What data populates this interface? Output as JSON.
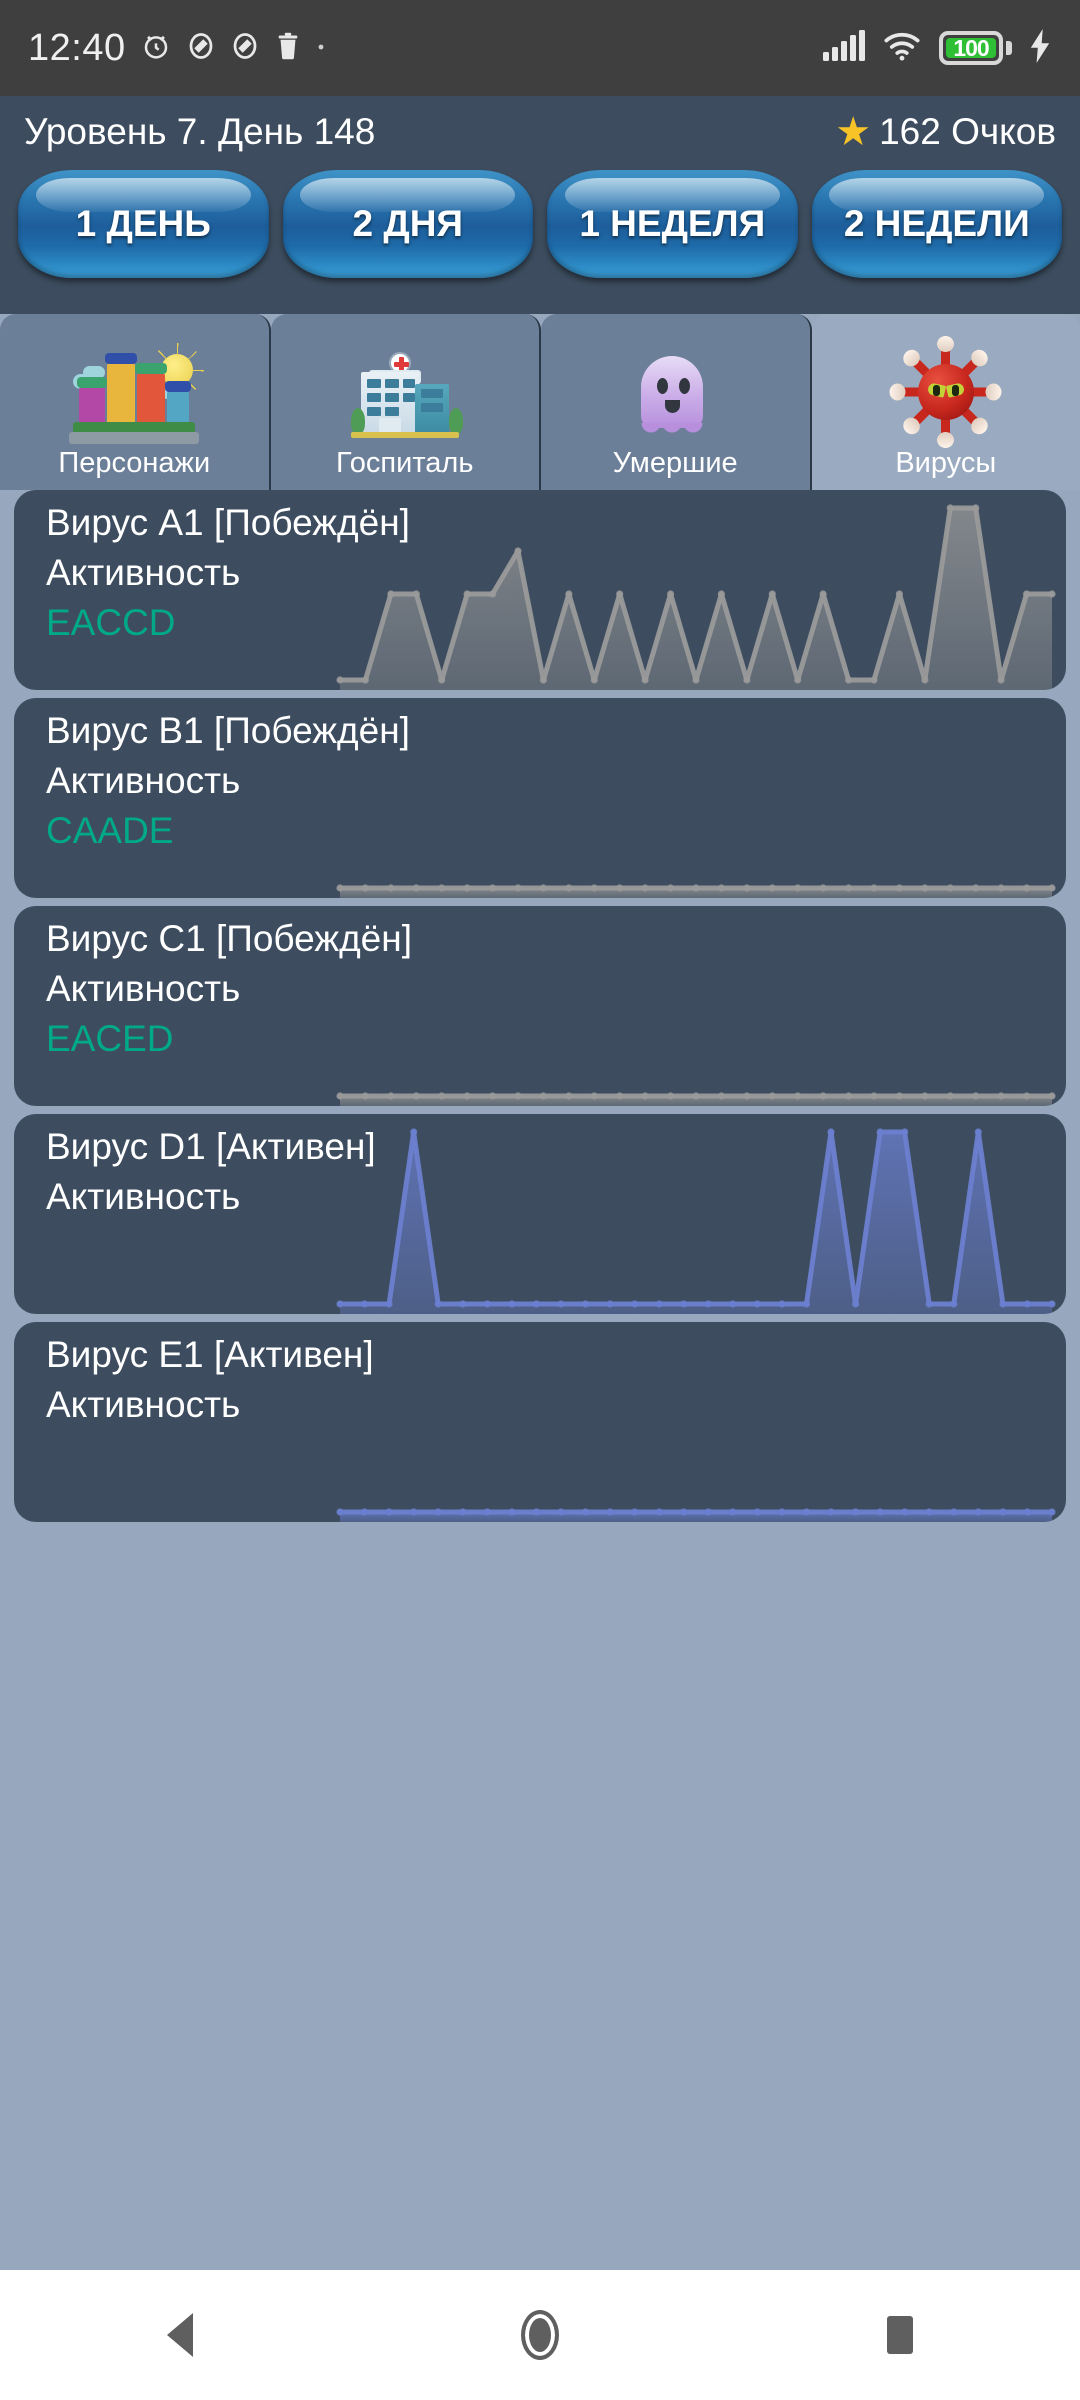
{
  "status_bar": {
    "clock": "12:40",
    "left_icons": [
      "alarm-icon",
      "do-not-disturb-icon",
      "do-not-disturb-icon",
      "trash-icon",
      "dot-icon"
    ],
    "right_icons": [
      "signal-icon",
      "wifi-icon"
    ],
    "battery_percent": "100",
    "battery_color": "#2fbf34",
    "charging": true
  },
  "header": {
    "level_text": "Уровень 7. День 148",
    "score_text": "162 Очков",
    "star_icon": "star-icon",
    "speed_buttons": [
      {
        "label": "1 ДЕНЬ"
      },
      {
        "label": "2 ДНЯ"
      },
      {
        "label": "1 НЕДЕЛЯ"
      },
      {
        "label": "2 НЕДЕЛИ"
      }
    ]
  },
  "tabs": [
    {
      "label": "Персонажи",
      "icon": "city-icon",
      "active": false
    },
    {
      "label": "Госпиталь",
      "icon": "hospital-icon",
      "active": false
    },
    {
      "label": "Умершие",
      "icon": "ghost-icon",
      "active": false
    },
    {
      "label": "Вирусы",
      "icon": "virus-icon",
      "active": true
    }
  ],
  "colors": {
    "page_background": "#96a7be",
    "card_background": "#3d4d5f",
    "header_background": "#3d4d5f",
    "code_text": "#00a98a",
    "defeated_chart": "#9a9a9a",
    "active_chart": "#6b7fd0"
  },
  "cards": [
    {
      "title": "Вирус A1 [Побеждён]",
      "subtitle": "Активность",
      "code": "EACCD",
      "status": "Побеждён",
      "chart_color": "#9a9a9a"
    },
    {
      "title": "Вирус B1 [Побеждён]",
      "subtitle": "Активность",
      "code": "CAADE",
      "status": "Побеждён",
      "chart_color": "#9a9a9a"
    },
    {
      "title": "Вирус C1 [Побеждён]",
      "subtitle": "Активность",
      "code": "EACED",
      "status": "Побеждён",
      "chart_color": "#9a9a9a"
    },
    {
      "title": "Вирус D1 [Активен]",
      "subtitle": "Активность",
      "code": "",
      "status": "Активен",
      "chart_color": "#6b7fd0"
    },
    {
      "title": "Вирус E1 [Активен]",
      "subtitle": "Активность",
      "code": "",
      "status": "Активен",
      "chart_color": "#6b7fd0"
    }
  ],
  "chart_data": [
    {
      "type": "area",
      "title": "Вирус A1 Активность",
      "series": [
        {
          "name": "Активность",
          "values": [
            0,
            0,
            2,
            2,
            0,
            2,
            2,
            3,
            0,
            2,
            0,
            2,
            0,
            2,
            0,
            2,
            0,
            2,
            0,
            2,
            0,
            0,
            2,
            0,
            4,
            4,
            0,
            2,
            2
          ]
        }
      ],
      "x": [
        1,
        2,
        3,
        4,
        5,
        6,
        7,
        8,
        9,
        10,
        11,
        12,
        13,
        14,
        15,
        16,
        17,
        18,
        19,
        20,
        21,
        22,
        23,
        24,
        25,
        26,
        27,
        28,
        29
      ],
      "ylim": [
        0,
        4
      ],
      "grid": false,
      "legend": "none",
      "color": "#9a9a9a"
    },
    {
      "type": "area",
      "title": "Вирус B1 Активность",
      "series": [
        {
          "name": "Активность",
          "values": [
            0,
            0,
            0,
            0,
            0,
            0,
            0,
            0,
            0,
            0,
            0,
            0,
            0,
            0,
            0,
            0,
            0,
            0,
            0,
            0,
            0,
            0,
            0,
            0,
            0,
            0,
            0,
            0,
            0
          ]
        }
      ],
      "x": [
        1,
        2,
        3,
        4,
        5,
        6,
        7,
        8,
        9,
        10,
        11,
        12,
        13,
        14,
        15,
        16,
        17,
        18,
        19,
        20,
        21,
        22,
        23,
        24,
        25,
        26,
        27,
        28,
        29
      ],
      "ylim": [
        0,
        4
      ],
      "grid": false,
      "legend": "none",
      "color": "#9a9a9a"
    },
    {
      "type": "area",
      "title": "Вирус C1 Активность",
      "series": [
        {
          "name": "Активность",
          "values": [
            0,
            0,
            0,
            0,
            0,
            0,
            0,
            0,
            0,
            0,
            0,
            0,
            0,
            0,
            0,
            0,
            0,
            0,
            0,
            0,
            0,
            0,
            0,
            0,
            0,
            0,
            0,
            0,
            0
          ]
        }
      ],
      "x": [
        1,
        2,
        3,
        4,
        5,
        6,
        7,
        8,
        9,
        10,
        11,
        12,
        13,
        14,
        15,
        16,
        17,
        18,
        19,
        20,
        21,
        22,
        23,
        24,
        25,
        26,
        27,
        28,
        29
      ],
      "ylim": [
        0,
        4
      ],
      "grid": false,
      "legend": "none",
      "color": "#9a9a9a"
    },
    {
      "type": "area",
      "title": "Вирус D1 Активность",
      "series": [
        {
          "name": "Активность",
          "values": [
            0,
            0,
            0,
            4,
            0,
            0,
            0,
            0,
            0,
            0,
            0,
            0,
            0,
            0,
            0,
            0,
            0,
            0,
            0,
            0,
            4,
            0,
            4,
            4,
            0,
            0,
            4,
            0,
            0,
            0
          ]
        }
      ],
      "x": [
        1,
        2,
        3,
        4,
        5,
        6,
        7,
        8,
        9,
        10,
        11,
        12,
        13,
        14,
        15,
        16,
        17,
        18,
        19,
        20,
        21,
        22,
        23,
        24,
        25,
        26,
        27,
        28,
        29,
        30
      ],
      "ylim": [
        0,
        4
      ],
      "grid": false,
      "legend": "none",
      "color": "#6b7fd0"
    },
    {
      "type": "area",
      "title": "Вирус E1 Активность",
      "series": [
        {
          "name": "Активность",
          "values": [
            0,
            0,
            0,
            0,
            0,
            0,
            0,
            0,
            0,
            0,
            0,
            0,
            0,
            0,
            0,
            0,
            0,
            0,
            0,
            0,
            0,
            0,
            0,
            0,
            0,
            0,
            0,
            0,
            0,
            0
          ]
        }
      ],
      "x": [
        1,
        2,
        3,
        4,
        5,
        6,
        7,
        8,
        9,
        10,
        11,
        12,
        13,
        14,
        15,
        16,
        17,
        18,
        19,
        20,
        21,
        22,
        23,
        24,
        25,
        26,
        27,
        28,
        29,
        30
      ],
      "ylim": [
        0,
        4
      ],
      "grid": false,
      "legend": "none",
      "color": "#6b7fd0"
    }
  ],
  "nav_bar": {
    "back": "back-triangle-icon",
    "home": "home-circle-icon",
    "recents": "recents-square-icon"
  }
}
